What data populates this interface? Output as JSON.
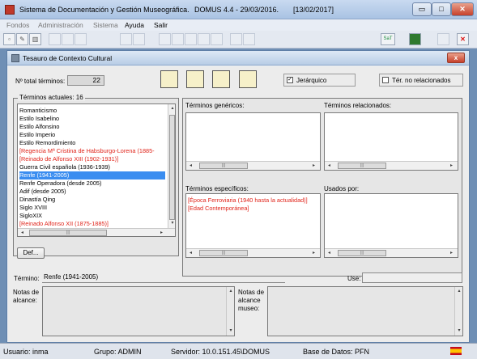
{
  "window": {
    "title": "Sistema de Documentación y Gestión Museográfica.",
    "version": "DOMUS 4.4 - 29/03/2016.",
    "date": "[13/02/2017]",
    "min_glyph": "▭",
    "max_glyph": "□",
    "close_glyph": "✕"
  },
  "menu": {
    "items": [
      "Fondos",
      "Administración",
      "Sistema",
      "Ayuda",
      "Salir"
    ]
  },
  "toolbar": {
    "right_label": "SaT",
    "cancel_glyph": "✕"
  },
  "dialog": {
    "title": "Tesauro de  Contexto Cultural",
    "close_glyph": "x",
    "total_label": "Nº total términos:",
    "total_value": "22",
    "jerarquico_label": "Jerárquico",
    "jerarquico_checked": "✓",
    "ter_no_rel_label": "Tér. no relacionados",
    "terminos_actuales_label": "Términos actuales:  16",
    "terms": [
      {
        "text": "Romanticismo",
        "style": "normal"
      },
      {
        "text": "Estilo Isabelino",
        "style": "normal"
      },
      {
        "text": "Estilo Alfonsino",
        "style": "normal"
      },
      {
        "text": "Estilo Imperio",
        "style": "normal"
      },
      {
        "text": "Estilo Remordimiento",
        "style": "normal"
      },
      {
        "text": "[Regencia Mª Cristina de Habsburgo-Lorena (1885-",
        "style": "red"
      },
      {
        "text": "[Reinado de Alfonso XIII (1902-1931)]",
        "style": "red"
      },
      {
        "text": "Guerra Civil española (1936-1939)",
        "style": "normal"
      },
      {
        "text": "Renfe (1941-2005)",
        "style": "selected"
      },
      {
        "text": "Renfe Operadora (desde 2005)",
        "style": "normal"
      },
      {
        "text": "Adif (desde 2005)",
        "style": "normal"
      },
      {
        "text": "Dinastía Qing",
        "style": "normal"
      },
      {
        "text": "Siglo XVIII",
        "style": "normal"
      },
      {
        "text": "SigloXIX",
        "style": "normal"
      },
      {
        "text": "[Reinado Alfonso XII (1875-1885)]",
        "style": "red"
      }
    ],
    "def_button": "Def...",
    "genericos_label": "Términos genéricos:",
    "relacionados_label": "Términos relacionados:",
    "especificos_label": "Términos específicos:",
    "especificos": [
      "[Época Ferroviaria (1940 hasta la actualidad)]",
      "[Edad Contemporánea]"
    ],
    "usados_label": "Usados por:",
    "termino_label": "Término:",
    "termino_value": "Renfe (1941-2005)",
    "use_label": "Use:",
    "use_value": "",
    "notas_alcance_label": "Notas de alcance:",
    "notas_alcance_museo_label": "Notas de alcance museo:"
  },
  "status": {
    "usuario": "Usuario:  inma",
    "grupo": "Grupo:  ADMIN",
    "servidor": "Servidor:  10.0.151.45\\DOMUS",
    "base": "Base de Datos:  PFN"
  },
  "scroll": {
    "left": "◂",
    "right": "▸",
    "up": "▴",
    "down": "▾",
    "grip": "|||"
  }
}
